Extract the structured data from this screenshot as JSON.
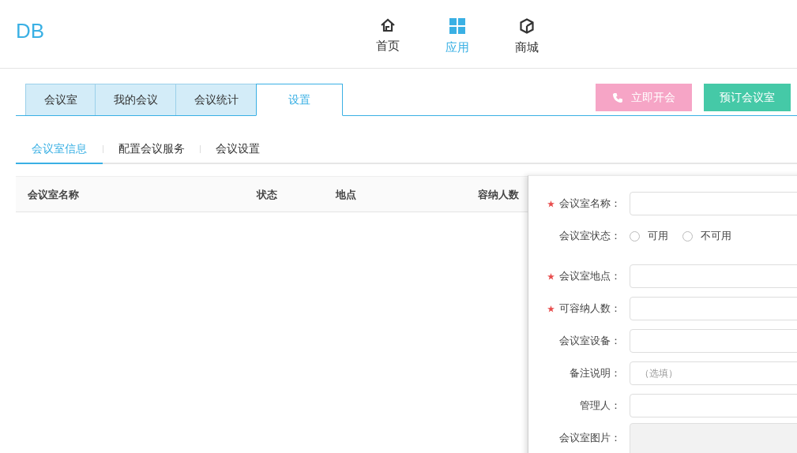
{
  "logo": "DB",
  "nav": [
    {
      "label": "首页",
      "kind": "home",
      "selected": false
    },
    {
      "label": "应用",
      "kind": "apps",
      "selected": true
    },
    {
      "label": "商城",
      "kind": "store",
      "selected": false
    }
  ],
  "tabs": [
    {
      "label": "会议室",
      "selected": false
    },
    {
      "label": "我的会议",
      "selected": false
    },
    {
      "label": "会议统计",
      "selected": false
    },
    {
      "label": "设置",
      "selected": true
    }
  ],
  "actions": [
    {
      "label": "立即开会",
      "kind": "call"
    },
    {
      "label": "预订会议室",
      "kind": "book"
    }
  ],
  "subtabs": [
    {
      "label": "会议室信息",
      "selected": true
    },
    {
      "label": "配置会议服务",
      "selected": false
    },
    {
      "label": "会议设置",
      "selected": false
    }
  ],
  "table": {
    "columns": [
      "会议室名称",
      "状态",
      "地点",
      "容纳人数"
    ]
  },
  "form": {
    "fields": [
      {
        "kind": "text",
        "label": "会议室名称：",
        "required": true
      },
      {
        "kind": "radio",
        "label": "会议室状态：",
        "required": false,
        "options": [
          {
            "label": "可用",
            "selected": false
          },
          {
            "label": "不可用",
            "selected": false
          }
        ]
      },
      {
        "kind": "text",
        "label": "会议室地点：",
        "required": true
      },
      {
        "kind": "text",
        "label": "可容纳人数：",
        "required": true
      },
      {
        "kind": "text",
        "label": "会议室设备：",
        "required": false
      },
      {
        "kind": "text",
        "label": "备注说明：",
        "required": false,
        "placeholder": "（选填）"
      },
      {
        "kind": "text",
        "label": "管理人：",
        "required": false
      },
      {
        "kind": "image",
        "label": "会议室图片：",
        "required": false
      }
    ]
  }
}
